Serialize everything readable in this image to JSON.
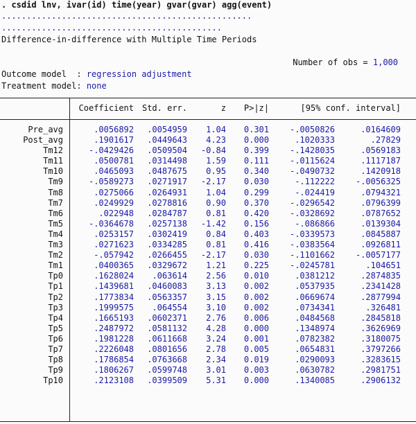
{
  "command": ". csdid lnv, ivar(id) time(year) gvar(gvar) agg(event)",
  "progress_dots_1": "..................................................",
  "progress_dots_2": "............................................",
  "description": "Difference-in-difference with Multiple Time Periods",
  "nobs": {
    "label": "Number of obs =",
    "value": "1,000"
  },
  "outcome_model": {
    "label": "Outcome model  :",
    "value": "regression adjustment"
  },
  "treatment_model": {
    "label": "Treatment model:",
    "value": "none"
  },
  "table": {
    "headers": [
      "Coefficient",
      "Std. err.",
      "z",
      "P>|z|",
      "[95% conf. interval]"
    ],
    "rows": [
      {
        "label": "Pre_avg",
        "coef": ".0056892",
        "se": ".0054959",
        "z": "1.04",
        "p": "0.301",
        "lo": "-.0050826",
        "hi": ".0164609"
      },
      {
        "label": "Post_avg",
        "coef": ".1901617",
        "se": ".0449643",
        "z": "4.23",
        "p": "0.000",
        "lo": ".1020333",
        "hi": ".27829"
      },
      {
        "label": "Tm12",
        "coef": "-.0429426",
        "se": ".0509504",
        "z": "-0.84",
        "p": "0.399",
        "lo": "-.1428035",
        "hi": ".0569183"
      },
      {
        "label": "Tm11",
        "coef": ".0500781",
        "se": ".0314498",
        "z": "1.59",
        "p": "0.111",
        "lo": "-.0115624",
        "hi": ".1117187"
      },
      {
        "label": "Tm10",
        "coef": ".0465093",
        "se": ".0487675",
        "z": "0.95",
        "p": "0.340",
        "lo": "-.0490732",
        "hi": ".1420918"
      },
      {
        "label": "Tm9",
        "coef": "-.0589273",
        "se": ".0271917",
        "z": "-2.17",
        "p": "0.030",
        "lo": "-.112222",
        "hi": "-.0056325"
      },
      {
        "label": "Tm8",
        "coef": ".0275066",
        "se": ".0264931",
        "z": "1.04",
        "p": "0.299",
        "lo": "-.024419",
        "hi": ".0794321"
      },
      {
        "label": "Tm7",
        "coef": ".0249929",
        "se": ".0278816",
        "z": "0.90",
        "p": "0.370",
        "lo": "-.0296542",
        "hi": ".0796399"
      },
      {
        "label": "Tm6",
        "coef": ".022948",
        "se": ".0284787",
        "z": "0.81",
        "p": "0.420",
        "lo": "-.0328692",
        "hi": ".0787652"
      },
      {
        "label": "Tm5",
        "coef": "-.0364678",
        "se": ".0257138",
        "z": "-1.42",
        "p": "0.156",
        "lo": "-.086866",
        "hi": ".0139304"
      },
      {
        "label": "Tm4",
        "coef": ".0253157",
        "se": ".0302419",
        "z": "0.84",
        "p": "0.403",
        "lo": "-.0339573",
        "hi": ".0845887"
      },
      {
        "label": "Tm3",
        "coef": ".0271623",
        "se": ".0334285",
        "z": "0.81",
        "p": "0.416",
        "lo": "-.0383564",
        "hi": ".0926811"
      },
      {
        "label": "Tm2",
        "coef": "-.057942",
        "se": ".0266455",
        "z": "-2.17",
        "p": "0.030",
        "lo": "-.1101662",
        "hi": "-.0057177"
      },
      {
        "label": "Tm1",
        "coef": ".0400365",
        "se": ".0329672",
        "z": "1.21",
        "p": "0.225",
        "lo": "-.0245781",
        "hi": ".104651"
      },
      {
        "label": "Tp0",
        "coef": ".1628024",
        "se": ".063614",
        "z": "2.56",
        "p": "0.010",
        "lo": ".0381212",
        "hi": ".2874835"
      },
      {
        "label": "Tp1",
        "coef": ".1439681",
        "se": ".0460083",
        "z": "3.13",
        "p": "0.002",
        "lo": ".0537935",
        "hi": ".2341428"
      },
      {
        "label": "Tp2",
        "coef": ".1773834",
        "se": ".0563357",
        "z": "3.15",
        "p": "0.002",
        "lo": ".0669674",
        "hi": ".2877994"
      },
      {
        "label": "Tp3",
        "coef": ".1999575",
        "se": ".064554",
        "z": "3.10",
        "p": "0.002",
        "lo": ".0734341",
        "hi": ".326481"
      },
      {
        "label": "Tp4",
        "coef": ".1665193",
        "se": ".0602371",
        "z": "2.76",
        "p": "0.006",
        "lo": ".0484568",
        "hi": ".2845818"
      },
      {
        "label": "Tp5",
        "coef": ".2487972",
        "se": ".0581132",
        "z": "4.28",
        "p": "0.000",
        "lo": ".1348974",
        "hi": ".3626969"
      },
      {
        "label": "Tp6",
        "coef": ".1981228",
        "se": ".0611668",
        "z": "3.24",
        "p": "0.001",
        "lo": ".0782382",
        "hi": ".3180075"
      },
      {
        "label": "Tp7",
        "coef": ".2226048",
        "se": ".0801656",
        "z": "2.78",
        "p": "0.005",
        "lo": ".0654831",
        "hi": ".3797266"
      },
      {
        "label": "Tp8",
        "coef": ".1786854",
        "se": ".0763668",
        "z": "2.34",
        "p": "0.019",
        "lo": ".0290093",
        "hi": ".3283615"
      },
      {
        "label": "Tp9",
        "coef": ".1806267",
        "se": ".0599748",
        "z": "3.01",
        "p": "0.003",
        "lo": ".0630782",
        "hi": ".2981751"
      },
      {
        "label": "Tp10",
        "coef": ".2123108",
        "se": ".0399509",
        "z": "5.31",
        "p": "0.000",
        "lo": ".1340085",
        "hi": ".2906132"
      }
    ]
  },
  "colors": {
    "text": "#111111",
    "result_blue": "#1a1aa6",
    "background": "#fbfbfb"
  }
}
